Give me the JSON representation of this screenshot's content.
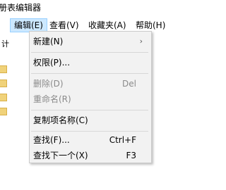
{
  "window": {
    "title": "册表编辑器"
  },
  "menu_bar": {
    "items": [
      {
        "label": "编辑(E)",
        "active": true
      },
      {
        "label": "查看(V)",
        "active": false
      },
      {
        "label": "收藏夹(A)",
        "active": false
      },
      {
        "label": "帮助(H)",
        "active": false
      }
    ]
  },
  "tree": {
    "header_text": "计"
  },
  "edit_menu": {
    "new": {
      "label": "新建(N)",
      "submenu_icon": "chevron-right-icon"
    },
    "permissions": {
      "label": "权限(P)..."
    },
    "delete": {
      "label": "删除(D)",
      "shortcut": "Del",
      "disabled": true
    },
    "rename": {
      "label": "重命名(R)",
      "disabled": true
    },
    "copy_key_name": {
      "label": "复制项名称(C)"
    },
    "find": {
      "label": "查找(F)...",
      "shortcut": "Ctrl+F"
    },
    "find_next": {
      "label": "查找下一个(X)",
      "shortcut": "F3"
    }
  },
  "colors": {
    "menu_active_bg": "#cce8ff",
    "menu_active_border": "#99d1ff",
    "dropdown_bg": "#f2f2f2",
    "disabled_text": "#8a8a8a",
    "folder": "#f0d27a"
  }
}
